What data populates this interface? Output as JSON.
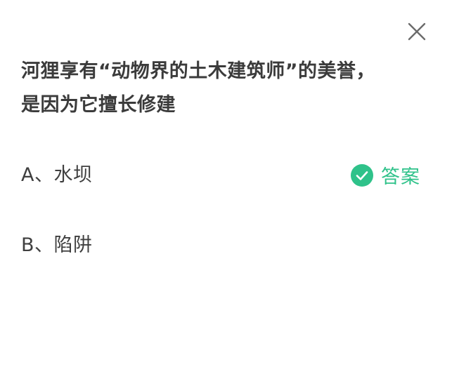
{
  "question": {
    "line1": "河狸享有“动物界的土木建筑师”的美誉，",
    "line2": "是因为它擅长修建"
  },
  "options": [
    {
      "label": "A、水坝",
      "is_answer": true
    },
    {
      "label": "B、陷阱",
      "is_answer": false
    }
  ],
  "answer_badge": {
    "label": "答案",
    "icon": "check-circle-icon",
    "color": "#2fc28a"
  },
  "close": {
    "icon": "close-icon",
    "color": "#6b6b6b"
  }
}
